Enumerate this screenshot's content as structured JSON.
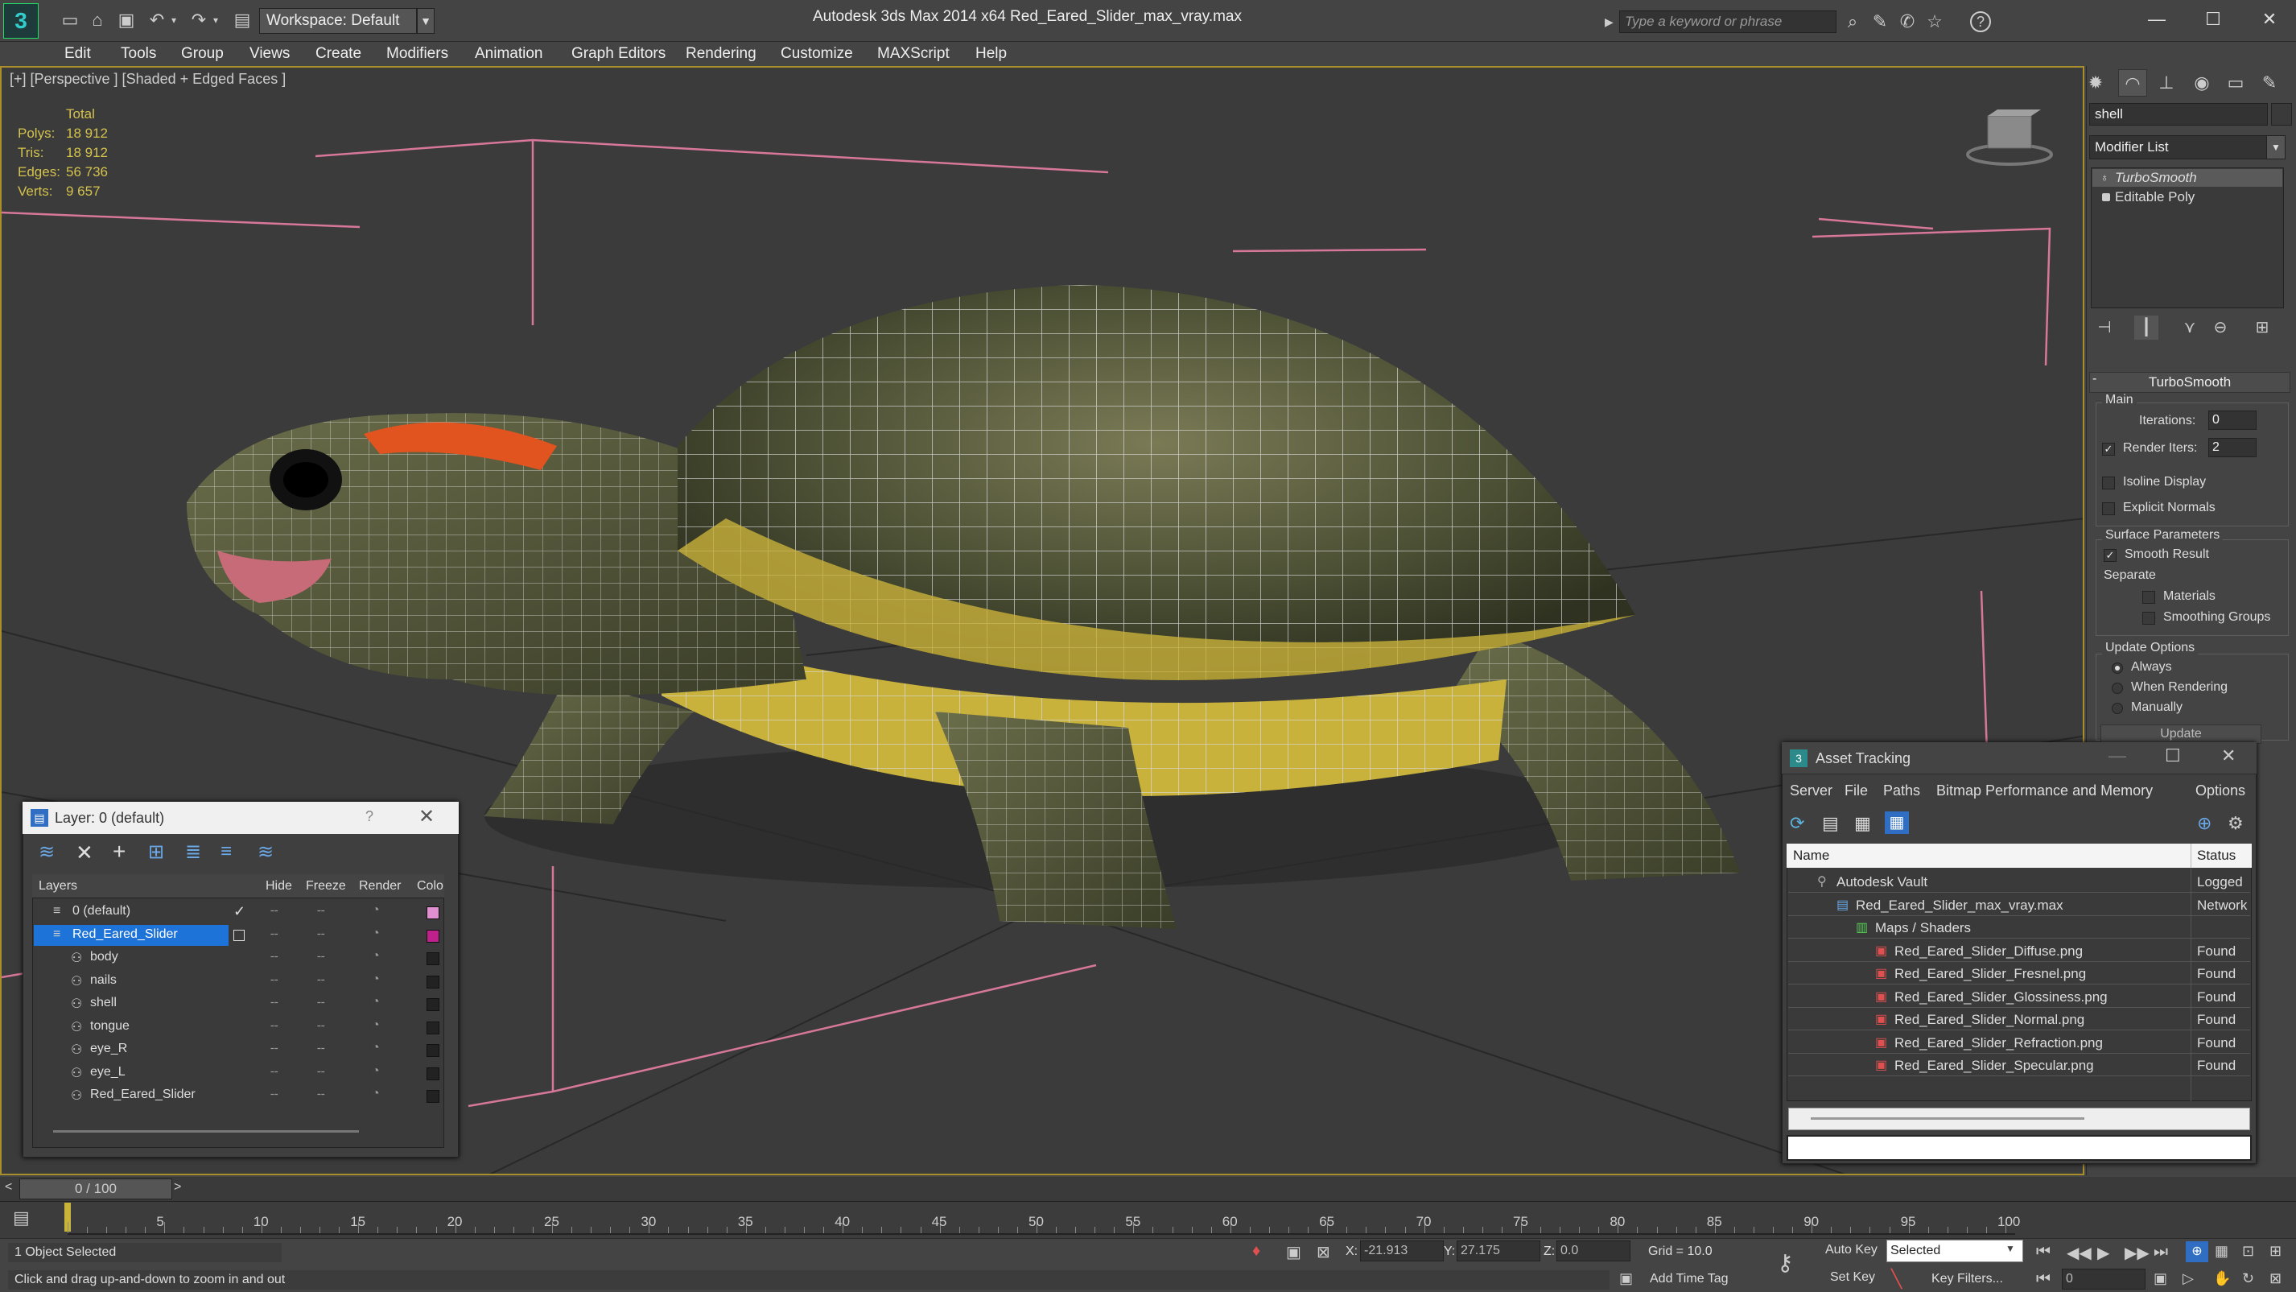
{
  "app": {
    "window_title": "Autodesk 3ds Max  2014 x64      Red_Eared_Slider_max_vray.max",
    "workspace_label": "Workspace: Default",
    "search_placeholder": "Type a keyword or phrase",
    "help_icon": "?"
  },
  "menu": [
    "Edit",
    "Tools",
    "Group",
    "Views",
    "Create",
    "Modifiers",
    "Animation",
    "Graph Editors",
    "Rendering",
    "Customize",
    "MAXScript",
    "Help"
  ],
  "viewport": {
    "label": "[+] [Perspective ] [Shaded + Edged Faces ]",
    "stats": {
      "header": "Total",
      "rows": [
        {
          "label": "Polys:",
          "value": "18 912"
        },
        {
          "label": "Tris:",
          "value": "18 912"
        },
        {
          "label": "Edges:",
          "value": "56 736"
        },
        {
          "label": "Verts:",
          "value": "9 657"
        }
      ]
    }
  },
  "command_panel": {
    "object_name": "shell",
    "modifier_list": "Modifier List",
    "stack": [
      "TurboSmooth",
      "Editable Poly"
    ],
    "rollout_title": "TurboSmooth",
    "main_group": "Main",
    "iterations_label": "Iterations:",
    "iterations_value": "0",
    "render_iters_label": "Render Iters:",
    "render_iters_value": "2",
    "isoline_label": "Isoline Display",
    "explicit_normals_label": "Explicit Normals",
    "surface_group": "Surface Parameters",
    "smooth_result_label": "Smooth Result",
    "separate_label": "Separate",
    "materials_label": "Materials",
    "smoothing_groups_label": "Smoothing Groups",
    "update_group": "Update Options",
    "always_label": "Always",
    "when_rendering_label": "When Rendering",
    "manually_label": "Manually",
    "update_button": "Update"
  },
  "layer_explorer": {
    "title": "Layer: 0 (default)",
    "help": "?",
    "columns": [
      "Layers",
      "Hide",
      "Freeze",
      "Render",
      "Colo"
    ],
    "rows": [
      {
        "name": "0 (default)",
        "level": 0,
        "kind": "layer",
        "color": "#e090d0"
      },
      {
        "name": "Red_Eared_Slider",
        "level": 0,
        "kind": "layer",
        "color": "#c0208c",
        "selected": true
      },
      {
        "name": "body",
        "level": 1,
        "kind": "object",
        "color": "#222222"
      },
      {
        "name": "nails",
        "level": 1,
        "kind": "object",
        "color": "#222222"
      },
      {
        "name": "shell",
        "level": 1,
        "kind": "object",
        "color": "#222222"
      },
      {
        "name": "tongue",
        "level": 1,
        "kind": "object",
        "color": "#222222"
      },
      {
        "name": "eye_R",
        "level": 1,
        "kind": "object",
        "color": "#222222"
      },
      {
        "name": "eye_L",
        "level": 1,
        "kind": "object",
        "color": "#222222"
      },
      {
        "name": "Red_Eared_Slider",
        "level": 1,
        "kind": "object",
        "color": "#222222"
      }
    ]
  },
  "asset_tracking": {
    "title": "Asset Tracking",
    "menu": [
      "Server",
      "File",
      "Paths",
      "Bitmap Performance and Memory",
      "Options"
    ],
    "columns": [
      "Name",
      "Status"
    ],
    "rows": [
      {
        "name": "Autodesk Vault",
        "status": "Logged",
        "level": 0
      },
      {
        "name": "Red_Eared_Slider_max_vray.max",
        "status": "Network",
        "level": 1
      },
      {
        "name": "Maps / Shaders",
        "status": "",
        "level": 2
      },
      {
        "name": "Red_Eared_Slider_Diffuse.png",
        "status": "Found",
        "level": 3
      },
      {
        "name": "Red_Eared_Slider_Fresnel.png",
        "status": "Found",
        "level": 3
      },
      {
        "name": "Red_Eared_Slider_Glossiness.png",
        "status": "Found",
        "level": 3
      },
      {
        "name": "Red_Eared_Slider_Normal.png",
        "status": "Found",
        "level": 3
      },
      {
        "name": "Red_Eared_Slider_Refraction.png",
        "status": "Found",
        "level": 3
      },
      {
        "name": "Red_Eared_Slider_Specular.png",
        "status": "Found",
        "level": 3
      }
    ]
  },
  "timeline": {
    "frame_label": "0 / 100",
    "ticks": [
      "5",
      "10",
      "15",
      "20",
      "25",
      "30",
      "35",
      "40",
      "45",
      "50",
      "55",
      "60",
      "65",
      "70",
      "75",
      "80",
      "85",
      "90",
      "95",
      "100"
    ]
  },
  "status": {
    "selection": "1 Object Selected",
    "prompt": "Click and drag up-and-down to zoom in and out",
    "x_label": "X:",
    "x_value": "-21.913",
    "y_label": "Y:",
    "y_value": "27.175",
    "z_label": "Z:",
    "z_value": "0.0",
    "grid": "Grid = 10.0",
    "add_time_tag": "Add Time Tag",
    "auto_key": "Auto Key",
    "set_key": "Set Key",
    "selected_dropdown": "Selected",
    "key_filters": "Key Filters...",
    "frame_value": "0"
  }
}
